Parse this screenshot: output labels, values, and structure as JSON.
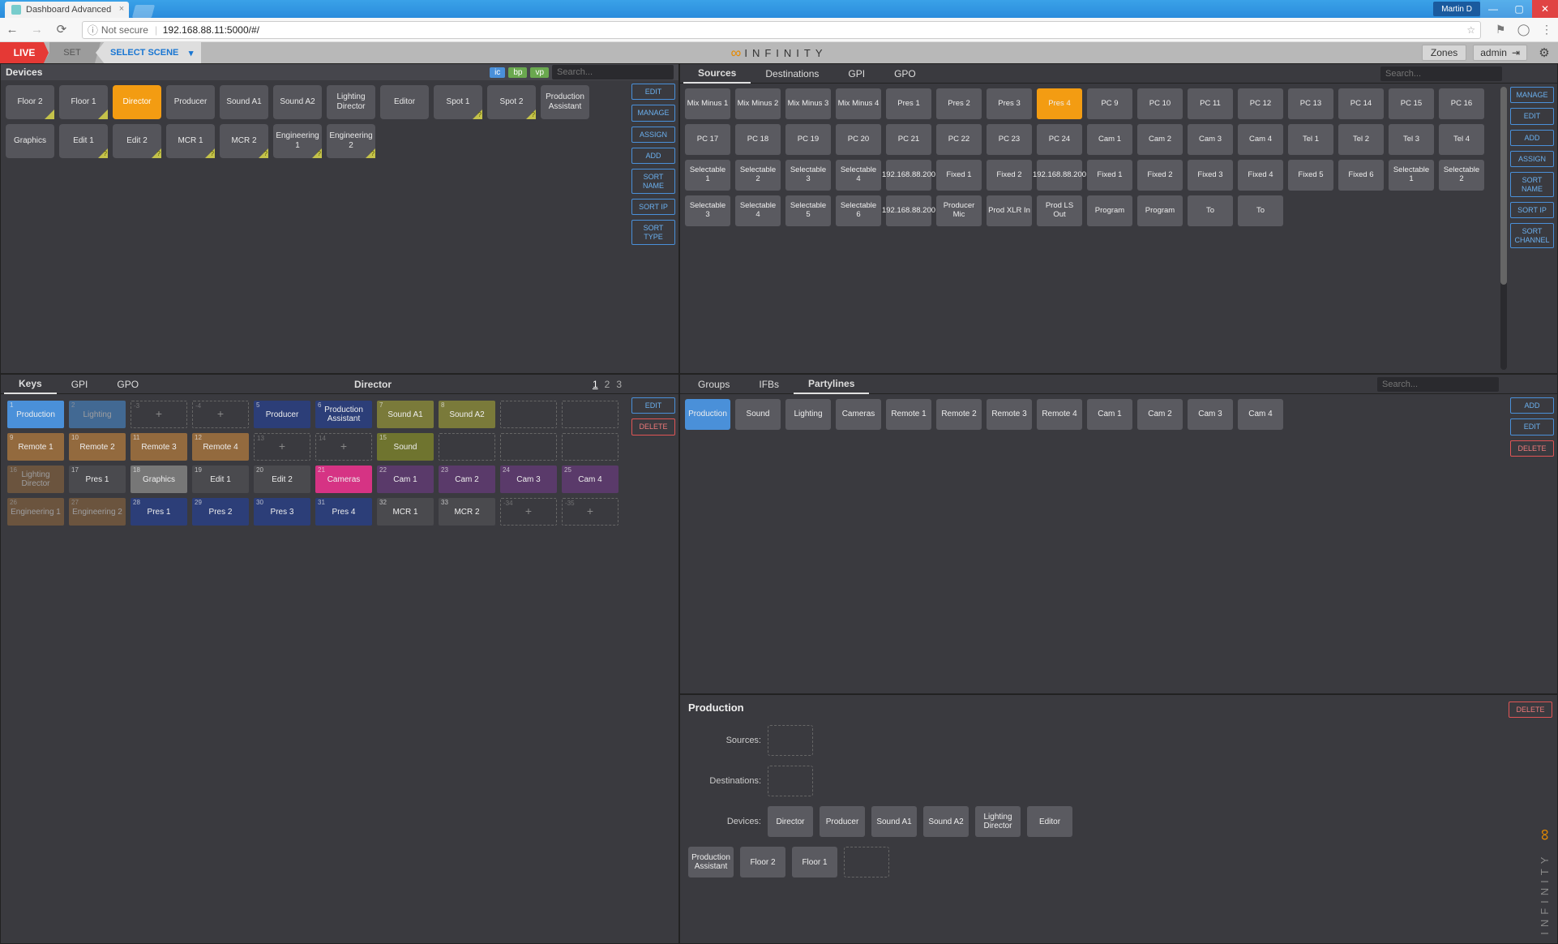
{
  "browser": {
    "tab_title": "Dashboard Advanced",
    "user_badge": "Martin D",
    "insecure_label": "Not secure",
    "url": "192.168.88.11:5000/#/"
  },
  "topbar": {
    "live": "LIVE",
    "set": "SET",
    "scene": "SELECT SCENE",
    "logo": "INFINITY",
    "zones": "Zones",
    "admin": "admin"
  },
  "devices": {
    "title": "Devices",
    "pills": {
      "ic": "ic",
      "bp": "bp",
      "vp": "vp"
    },
    "search_placeholder": "Search...",
    "actions": [
      "EDIT",
      "MANAGE",
      "ASSIGN",
      "ADD",
      "SORT NAME",
      "SORT IP",
      "SORT TYPE"
    ],
    "tiles": [
      {
        "label": "Floor 2",
        "corner": true
      },
      {
        "label": "Floor 1",
        "corner": true
      },
      {
        "label": "Director",
        "selected": true
      },
      {
        "label": "Producer"
      },
      {
        "label": "Sound A1"
      },
      {
        "label": "Sound A2"
      },
      {
        "label": "Lighting Director"
      },
      {
        "label": "Editor"
      },
      {
        "label": "Spot 1",
        "corner": true,
        "q": true
      },
      {
        "label": "Spot 2",
        "corner": true,
        "q": true
      },
      {
        "label": "Production Assistant"
      },
      {
        "label": "Graphics"
      },
      {
        "label": "Edit 1",
        "corner": true,
        "q": true
      },
      {
        "label": "Edit 2",
        "corner": true,
        "q": true
      },
      {
        "label": "MCR 1",
        "corner": true,
        "q": true
      },
      {
        "label": "MCR 2",
        "corner": true,
        "q": true
      },
      {
        "label": "Engineering 1",
        "corner": true,
        "q": true
      },
      {
        "label": "Engineering 2",
        "corner": true,
        "q": true
      }
    ]
  },
  "sources": {
    "tabs": [
      "Sources",
      "Destinations",
      "GPI",
      "GPO"
    ],
    "active_tab": 0,
    "search_placeholder": "Search...",
    "actions": [
      "MANAGE",
      "EDIT",
      "ADD",
      "ASSIGN",
      "SORT NAME",
      "SORT IP",
      "SORT CHANNEL"
    ],
    "tiles": [
      "Mix Minus 1",
      "Mix Minus 2",
      "Mix Minus 3",
      "Mix Minus 4",
      "Pres 1",
      "Pres 2",
      "Pres 3",
      "Pres 4",
      "PC 9",
      "PC 10",
      "PC 11",
      "PC 12",
      "PC 13",
      "PC 14",
      "PC 15",
      "PC 16",
      "PC 17",
      "PC 18",
      "PC 19",
      "PC 20",
      "PC 21",
      "PC 22",
      "PC 23",
      "PC 24",
      "Cam 1",
      "Cam 2",
      "Cam 3",
      "Cam 4",
      "Tel 1",
      "Tel 2",
      "Tel 3",
      "Tel 4",
      "Selectable 1",
      "Selectable 2",
      "Selectable 3",
      "Selectable 4",
      "192.168.88.200",
      "Fixed 1",
      "Fixed 2",
      "192.168.88.200",
      "Fixed 1",
      "Fixed 2",
      "Fixed 3",
      "Fixed 4",
      "Fixed 5",
      "Fixed 6",
      "Selectable 1",
      "Selectable 2",
      "Selectable 3",
      "Selectable 4",
      "Selectable 5",
      "Selectable 6",
      "192.168.88.200",
      "Producer Mic",
      "Prod XLR In",
      "Prod LS Out",
      "Program",
      "Program",
      "To",
      "To"
    ],
    "selected_index": 7
  },
  "keys": {
    "tabs": [
      "Keys",
      "GPI",
      "GPO"
    ],
    "active_tab": 0,
    "page_title": "Director",
    "pages": [
      "1",
      "2",
      "3"
    ],
    "active_page": 0,
    "actions": [
      "EDIT",
      "DELETE"
    ],
    "cells": [
      {
        "n": "1",
        "label": "Production",
        "color": "c-blue"
      },
      {
        "n": "2",
        "label": "Lighting",
        "color": "c-blue c-dim"
      },
      {
        "n": "-3",
        "label": "",
        "empty": true,
        "plus": true
      },
      {
        "n": "-4",
        "label": "",
        "empty": true,
        "plus": true
      },
      {
        "n": "5",
        "label": "Producer",
        "color": "c-navy"
      },
      {
        "n": "6",
        "label": "Production Assistant",
        "color": "c-navy"
      },
      {
        "n": "7",
        "label": "Sound A1",
        "color": "c-olive"
      },
      {
        "n": "8",
        "label": "Sound A2",
        "color": "c-olive"
      },
      {
        "n": "",
        "label": "",
        "empty": true
      },
      {
        "n": "",
        "label": "",
        "empty": true
      },
      {
        "n": "9",
        "label": "Remote 1",
        "color": "c-brown"
      },
      {
        "n": "10",
        "label": "Remote 2",
        "color": "c-brown"
      },
      {
        "n": "11",
        "label": "Remote 3",
        "color": "c-brown"
      },
      {
        "n": "12",
        "label": "Remote 4",
        "color": "c-brown"
      },
      {
        "n": "13",
        "label": "",
        "empty": true,
        "plus": true
      },
      {
        "n": "14",
        "label": "",
        "empty": true,
        "plus": true
      },
      {
        "n": "15",
        "label": "Sound",
        "color": "c-olive2"
      },
      {
        "n": "",
        "label": "",
        "empty": true
      },
      {
        "n": "",
        "label": "",
        "empty": true
      },
      {
        "n": "",
        "label": "",
        "empty": true
      },
      {
        "n": "16",
        "label": "Lighting Director",
        "color": "c-brown c-dim"
      },
      {
        "n": "17",
        "label": "Pres 1",
        "color": "c-dgrey"
      },
      {
        "n": "18",
        "label": "Graphics",
        "color": "c-grey"
      },
      {
        "n": "19",
        "label": "Edit 1",
        "color": "c-dgrey"
      },
      {
        "n": "20",
        "label": "Edit 2",
        "color": "c-dgrey"
      },
      {
        "n": "21",
        "label": "Cameras",
        "color": "c-magenta"
      },
      {
        "n": "22",
        "label": "Cam 1",
        "color": "c-purple"
      },
      {
        "n": "23",
        "label": "Cam 2",
        "color": "c-purple"
      },
      {
        "n": "24",
        "label": "Cam 3",
        "color": "c-purple"
      },
      {
        "n": "25",
        "label": "Cam 4",
        "color": "c-purple"
      },
      {
        "n": "26",
        "label": "Engineering 1",
        "color": "c-brown c-dim"
      },
      {
        "n": "27",
        "label": "Engineering 2",
        "color": "c-brown c-dim"
      },
      {
        "n": "28",
        "label": "Pres 1",
        "color": "c-navy"
      },
      {
        "n": "29",
        "label": "Pres 2",
        "color": "c-navy"
      },
      {
        "n": "30",
        "label": "Pres 3",
        "color": "c-navy"
      },
      {
        "n": "31",
        "label": "Pres 4",
        "color": "c-navy"
      },
      {
        "n": "32",
        "label": "MCR 1",
        "color": "c-dgrey"
      },
      {
        "n": "33",
        "label": "MCR 2",
        "color": "c-dgrey"
      },
      {
        "n": "-34",
        "label": "",
        "empty": true,
        "plus": true
      },
      {
        "n": "-35",
        "label": "",
        "empty": true,
        "plus": true
      }
    ]
  },
  "groups": {
    "tabs": [
      "Groups",
      "IFBs",
      "Partylines"
    ],
    "active_tab": 2,
    "search_placeholder": "Search...",
    "actions": [
      "ADD",
      "EDIT",
      "DELETE"
    ],
    "tiles": [
      {
        "label": "Production",
        "sel": true
      },
      {
        "label": "Sound"
      },
      {
        "label": "Lighting"
      },
      {
        "label": "Cameras"
      },
      {
        "label": "Remote 1"
      },
      {
        "label": "Remote 2"
      },
      {
        "label": "Remote 3"
      },
      {
        "label": "Remote 4"
      },
      {
        "label": "Cam 1"
      },
      {
        "label": "Cam 2"
      },
      {
        "label": "Cam 3"
      },
      {
        "label": "Cam 4"
      }
    ]
  },
  "detail": {
    "title": "Production",
    "actions": [
      "DELETE"
    ],
    "rows": {
      "sources_label": "Sources:",
      "dest_label": "Destinations:",
      "devices_label": "Devices:"
    },
    "devices": [
      "Director",
      "Producer",
      "Sound A1",
      "Sound A2",
      "Lighting Director",
      "Editor",
      "Production Assistant",
      "Floor 2",
      "Floor 1"
    ],
    "logo": "INFINITY"
  }
}
